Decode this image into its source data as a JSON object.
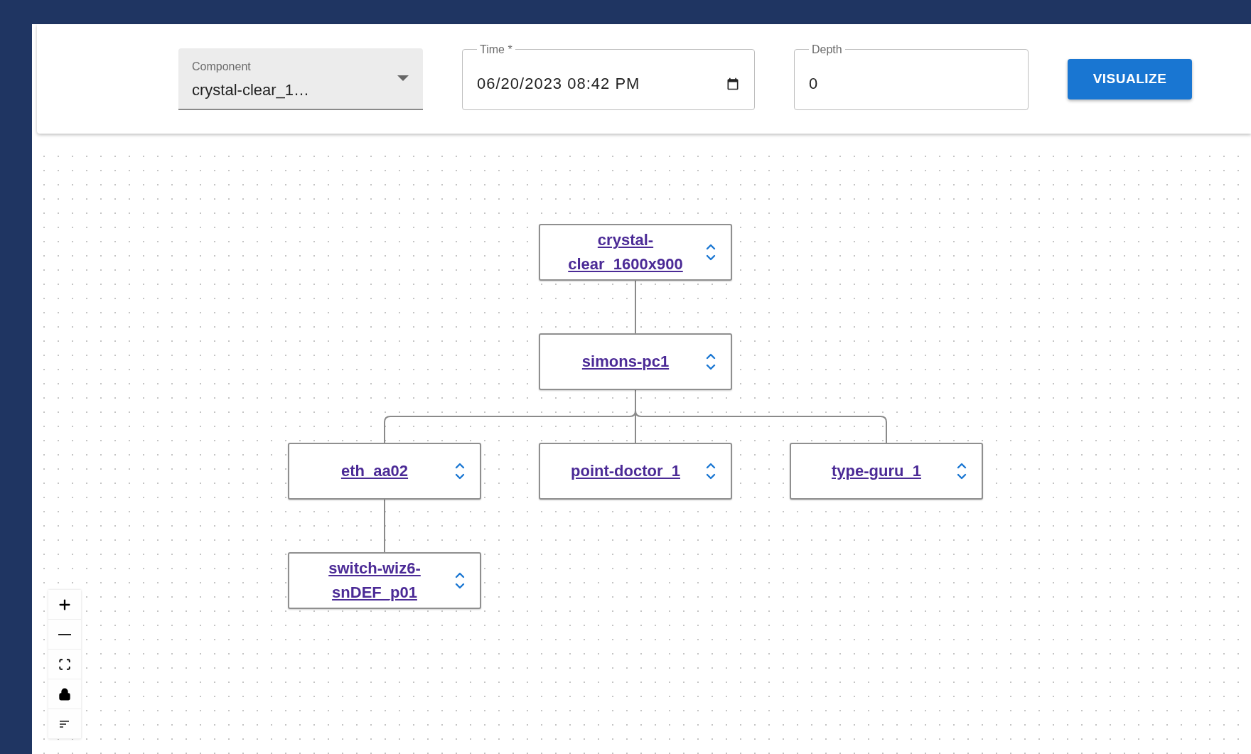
{
  "toolbar": {
    "component": {
      "label": "Component",
      "value": "crystal-clear_1…"
    },
    "time": {
      "label": "Time *",
      "value": "06/20/2023 08:42 PM"
    },
    "depth": {
      "label": "Depth",
      "value": "0"
    },
    "button": "VISUALIZE"
  },
  "graph": {
    "root": {
      "name": "crystal-clear_1600x900",
      "children": [
        {
          "name": "simons-pc1",
          "children": [
            {
              "name": "eth_aa02",
              "children": [
                {
                  "name": "switch-wiz6-snDEF_p01"
                }
              ]
            },
            {
              "name": "point-doctor_1"
            },
            {
              "name": "type-guru_1"
            }
          ]
        }
      ]
    }
  }
}
